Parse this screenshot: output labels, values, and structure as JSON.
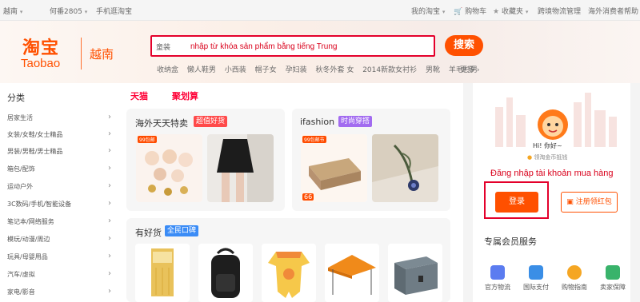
{
  "topbar": {
    "region": "越南",
    "greeting": "何番2805",
    "mobile": "手机逛淘宝",
    "my_taobao": "我的淘宝",
    "cart": "购物车",
    "favorites": "收藏夹",
    "logistics": "跨境物流管理",
    "help": "海外消费者帮助"
  },
  "header": {
    "logo_cn": "淘宝",
    "logo_en": "Taobao",
    "logo_region": "越南",
    "search_placeholder": "童装",
    "search_annotation": "nhập từ khóa sản phẩm bằng tiếng Trung",
    "search_button": "搜索",
    "hotwords": [
      "收纳盒",
      "懒人鞋男",
      "小西装",
      "帽子女",
      "孕妇装",
      "秋冬外套 女",
      "2014新款女衬衫",
      "男靴",
      "羊毛衫男"
    ],
    "more": "更多"
  },
  "categories": {
    "title": "分类",
    "items": [
      "居家生活",
      "女装/女鞋/女士精品",
      "男装/男鞋/男士精品",
      "箱包/配饰",
      "运动户外",
      "3C数码/手机/智能设备",
      "笔记本/网络服务",
      "模玩/动漫/周边",
      "玩具/母婴用品",
      "汽车/虚拟",
      "家电/影音"
    ]
  },
  "center": {
    "tab_tmall": "天猫",
    "tab_juhuasuan": "聚划算",
    "panel1": {
      "title": "海外天天特卖",
      "badge": "超值好货",
      "promo": "99包邮"
    },
    "panel2": {
      "title": "ifashion",
      "badge": "时尚穿搭",
      "promo": "99包邮节",
      "price": "66"
    },
    "panel3": {
      "title": "有好货",
      "badge": "全民口碑"
    }
  },
  "right": {
    "greeting": "Hi! 你好~",
    "coin_tip": "领淘金币抵钱",
    "login_annotation": "Đăng nhập tài khoản mua hàng",
    "login": "登录",
    "register": "注册领红包",
    "member_title": "专属会员服务",
    "services": [
      "官方物流",
      "国际支付",
      "购物指南",
      "卖家保障"
    ]
  },
  "colors": {
    "brand": "#ff5000",
    "annotation_red": "#d9001b",
    "tmall_red": "#ff0036"
  }
}
